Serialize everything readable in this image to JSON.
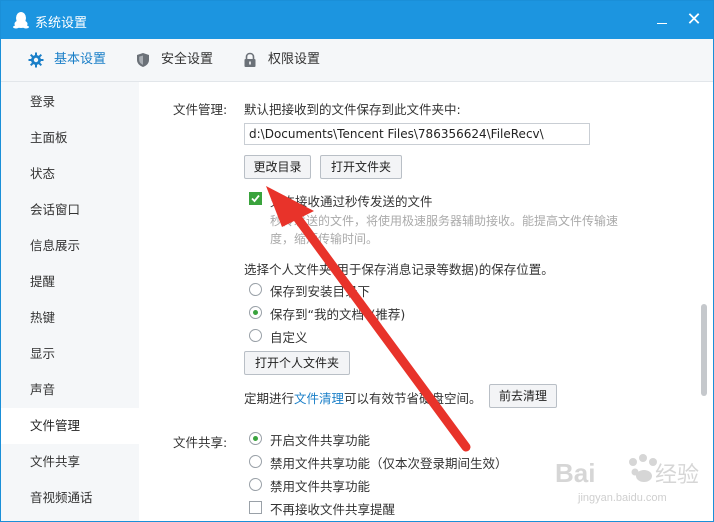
{
  "window": {
    "title": "系统设置"
  },
  "tabs": [
    {
      "label": "基本设置",
      "icon": "gear-icon",
      "active": true
    },
    {
      "label": "安全设置",
      "icon": "shield-icon",
      "active": false
    },
    {
      "label": "权限设置",
      "icon": "lock-icon",
      "active": false
    }
  ],
  "sidebar": {
    "items": [
      {
        "label": "登录"
      },
      {
        "label": "主面板"
      },
      {
        "label": "状态"
      },
      {
        "label": "会话窗口"
      },
      {
        "label": "信息展示"
      },
      {
        "label": "提醒"
      },
      {
        "label": "热键"
      },
      {
        "label": "显示"
      },
      {
        "label": "声音"
      },
      {
        "label": "文件管理",
        "active": true
      },
      {
        "label": "文件共享"
      },
      {
        "label": "音视频通话"
      }
    ]
  },
  "file_management": {
    "section_label": "文件管理:",
    "default_save_text": "默认把接收到的文件保存到此文件夹中:",
    "path_value": "d:\\Documents\\Tencent Files\\786356624\\FileRecv\\",
    "change_dir_button": "更改目录",
    "open_folder_button": "打开文件夹",
    "allow_instant_label": "允许接收通过秒传发送的文件",
    "allow_instant_checked": true,
    "desc_line1": "秒传发送的文件，将使用极速服务器辅助接收。能提高文件传输速",
    "desc_line2": "度，缩短传输时间。",
    "personal_folder_text": "选择个人文件夹(用于保存消息记录等数据)的保存位置。",
    "radio_options": [
      {
        "label": "保存到安装目录下",
        "checked": false
      },
      {
        "label": "保存到“我的文档”(推荐)",
        "checked": true
      },
      {
        "label": "自定义",
        "checked": false
      }
    ],
    "open_personal_button": "打开个人文件夹",
    "cleanup_prefix": "定期进行",
    "cleanup_link": "文件清理",
    "cleanup_suffix": "可以有效节省硬盘空间。",
    "cleanup_button": "前去清理"
  },
  "file_sharing": {
    "section_label": "文件共享:",
    "radio_options": [
      {
        "label": "开启文件共享功能",
        "checked": true
      },
      {
        "label": "禁用文件共享功能（仅本次登录期间生效）",
        "checked": false
      },
      {
        "label": "禁用文件共享功能",
        "checked": false
      }
    ],
    "no_remind_label": "不再接收文件共享提醒",
    "no_remind_checked": false
  },
  "watermark": {
    "brand": "Baidu 经验",
    "url": "jingyan.baidu.com"
  },
  "colors": {
    "titlebar": "#1c95e0",
    "accent": "#1a7fc8",
    "check_green": "#3aa33d",
    "arrow_red": "#e8332a"
  }
}
